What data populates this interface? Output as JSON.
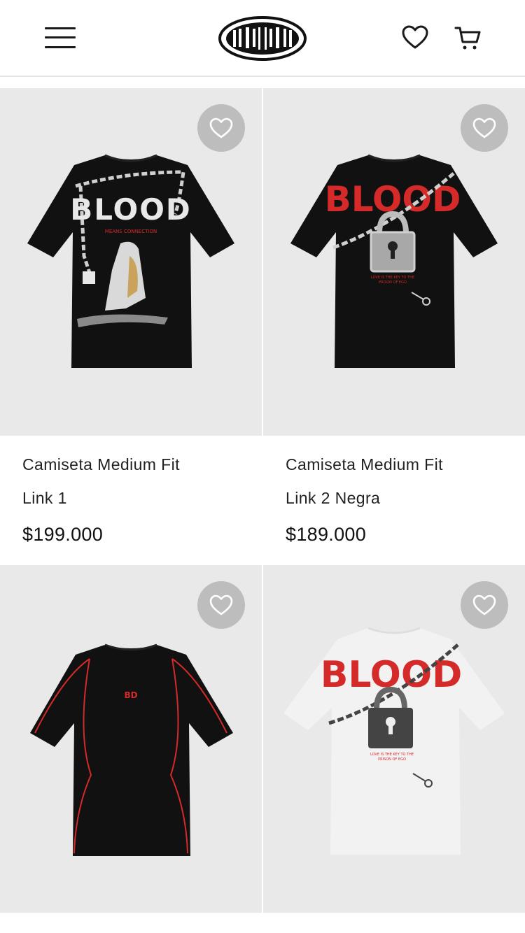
{
  "header": {
    "menu_icon": "hamburger-menu-icon",
    "logo": "brand-logo",
    "wishlist_icon": "heart-icon",
    "cart_icon": "cart-icon"
  },
  "products": [
    {
      "name_line1": "Camiseta Medium Fit",
      "name_line2": "Link 1",
      "price": "$199.000",
      "print_text": "BLOOD",
      "caption": "MEANS CONNECTION",
      "shirt_color": "#111111"
    },
    {
      "name_line1": "Camiseta Medium Fit",
      "name_line2": "Link 2 Negra",
      "price": "$189.000",
      "print_text": "BLOOD",
      "caption_line1": "LOVE IS THE KEY TO THE",
      "caption_line2": "PRISON OF EGO",
      "shirt_color": "#111111"
    },
    {
      "name_line1": "",
      "name_line2": "",
      "price": "",
      "print_text": "BD",
      "shirt_color": "#111111"
    },
    {
      "name_line1": "",
      "name_line2": "",
      "price": "",
      "print_text": "BLOOD",
      "caption_line1": "LOVE IS THE KEY TO THE",
      "caption_line2": "PRISON OF EGO",
      "shirt_color": "#f2f2f2"
    }
  ],
  "colors": {
    "accent_red": "#d42a2a",
    "card_bg": "#e9e9e9",
    "fav_bg": "#bdbdbd"
  }
}
